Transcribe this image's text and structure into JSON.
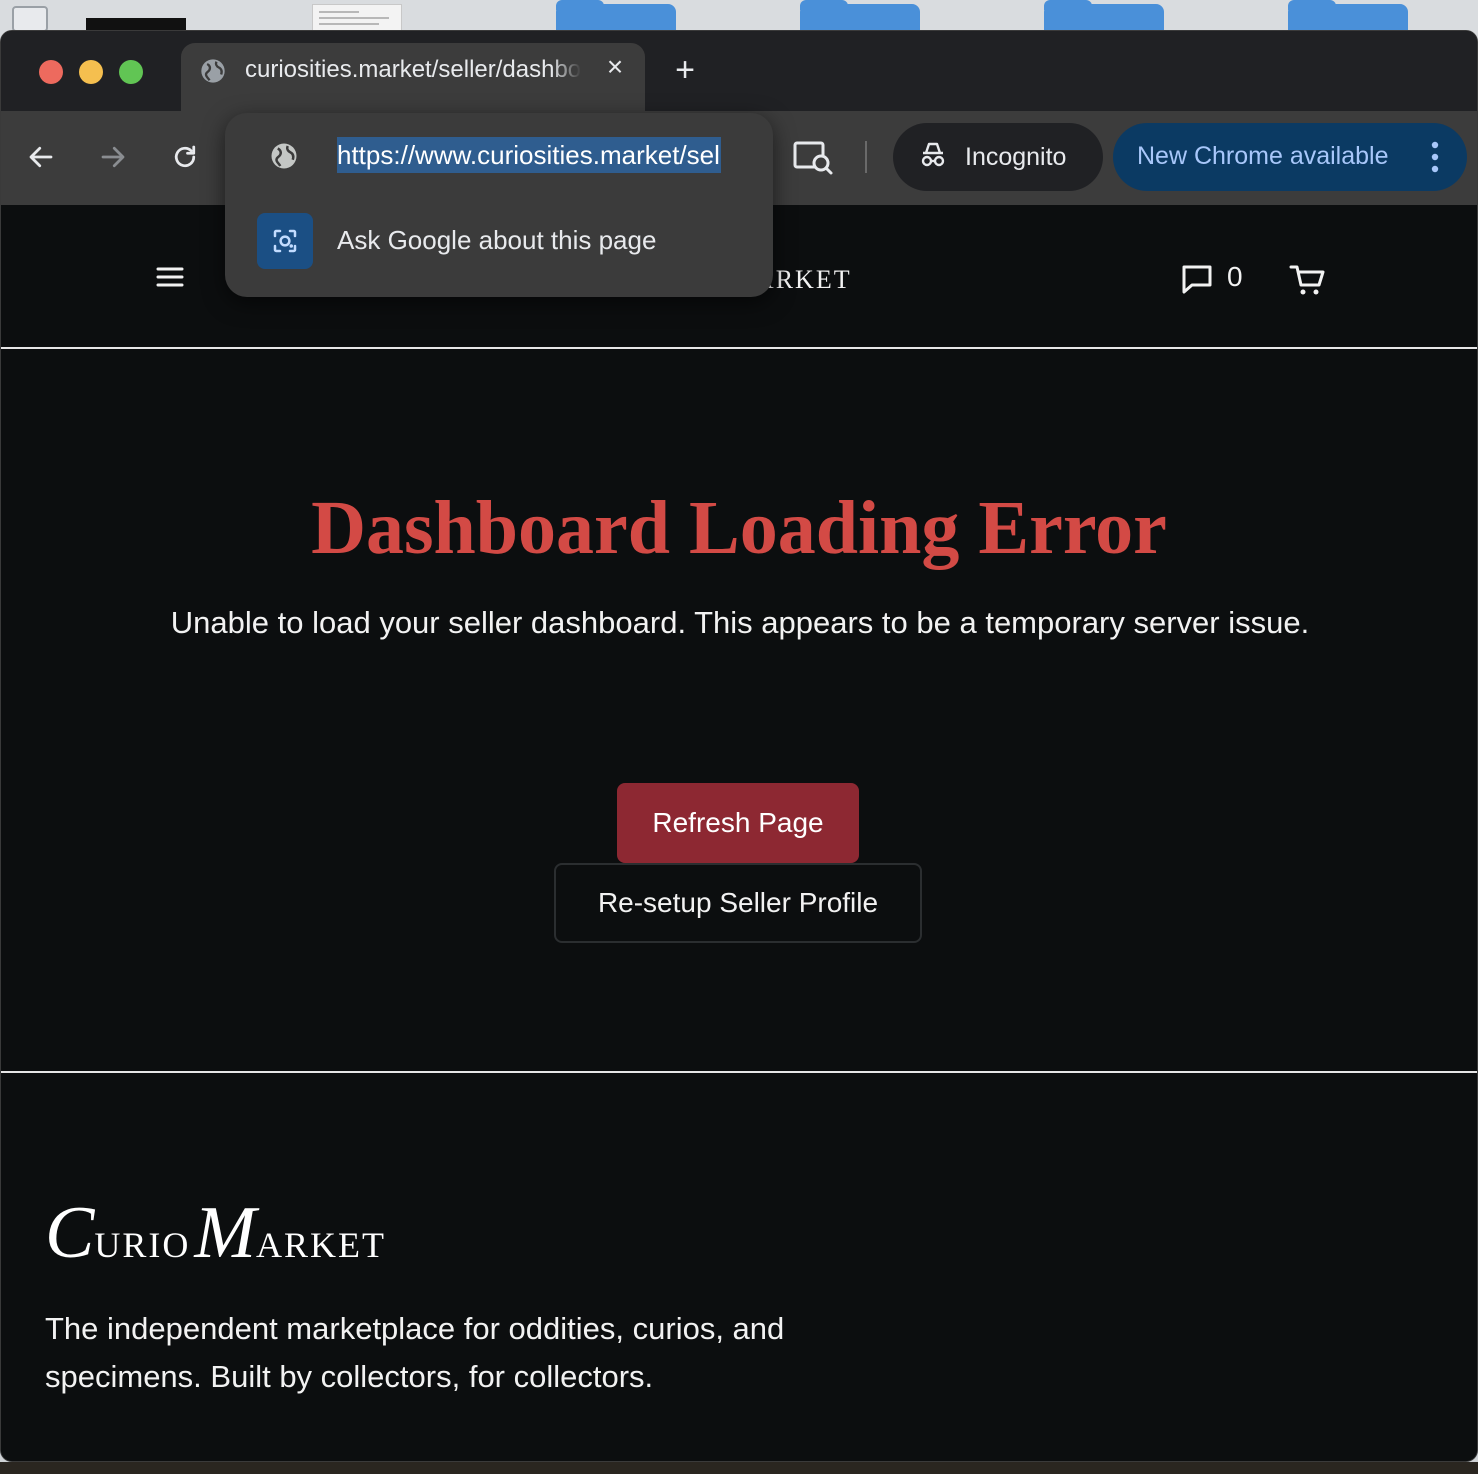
{
  "browser": {
    "tab": {
      "title": "curiosities.market/seller/dashboard",
      "close_glyph": "×"
    },
    "new_tab_glyph": "+",
    "omnibox": {
      "url": "https://www.curiosities.market/seller/dashboard",
      "suggestion": "Ask Google about this page"
    },
    "incognito_label": "Incognito",
    "update_label": "New Chrome available",
    "icons": [
      "back-arrow-icon",
      "forward-arrow-icon",
      "reload-icon",
      "globe-icon",
      "google-lens-icon",
      "incognito-icon",
      "more-vert-icon"
    ]
  },
  "site": {
    "header": {
      "logo_text": "CURIO MARKET",
      "message_count": "0",
      "icons": [
        "hamburger-icon",
        "message-icon",
        "cart-icon"
      ]
    },
    "error": {
      "title": "Dashboard Loading Error",
      "message": "Unable to load your seller dashboard. This appears to be a temporary server issue.",
      "primary_button": "Refresh Page",
      "secondary_button": "Re-setup Seller Profile"
    },
    "footer": {
      "logo_c": "C",
      "logo_urio": "URIO",
      "logo_m": "M",
      "logo_arket": "ARKET",
      "tagline": "The independent marketplace for oddities, curios, and specimens. Built by collectors, for collectors."
    }
  },
  "colors": {
    "page_bg": "#0c0e0f",
    "error_red": "#d34a45",
    "refresh_button": "#8d2832",
    "chrome_toolbar": "#3c3c3c",
    "update_chip": "#0b3a63"
  }
}
